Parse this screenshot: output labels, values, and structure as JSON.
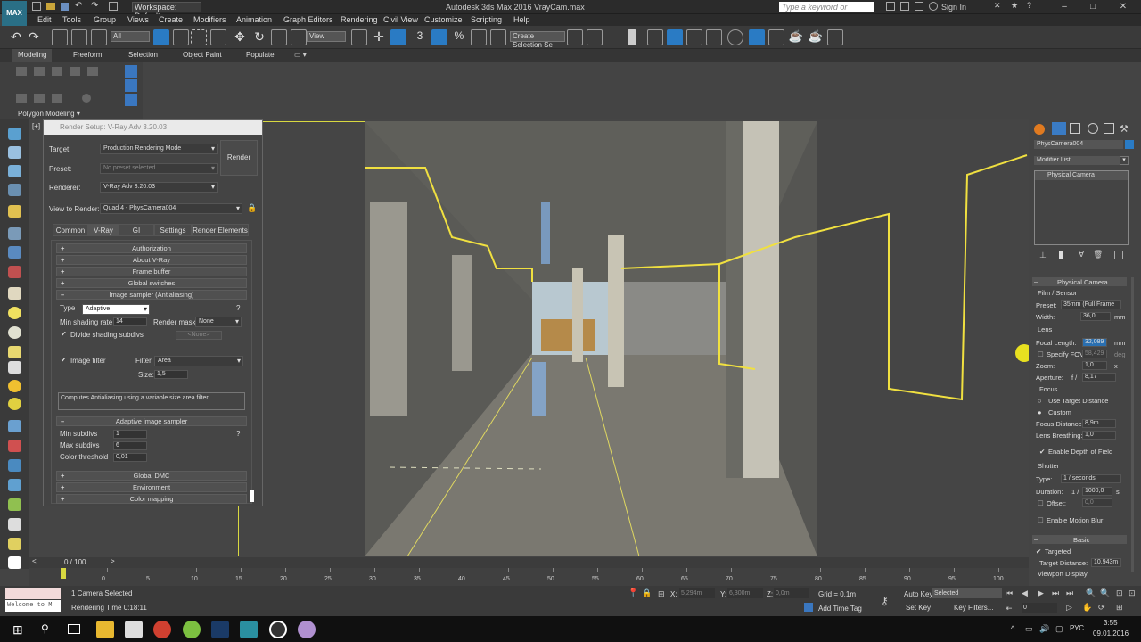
{
  "titlebar": {
    "logo": "MAX",
    "workspace": "Workspace: Default",
    "app_title": "Autodesk 3ds Max 2016    VrayCam.max",
    "search_placeholder": "Type a keyword or phrase",
    "sign_in": "Sign In",
    "min": "–",
    "max": "□",
    "close": "✕"
  },
  "menu": {
    "items": [
      "Edit",
      "Tools",
      "Group",
      "Views",
      "Create",
      "Modifiers",
      "Animation",
      "Graph Editors",
      "Rendering",
      "Civil View",
      "Customize",
      "Scripting",
      "Help"
    ]
  },
  "toolbar": {
    "selection_filter": "All",
    "ref_coord": "View",
    "named_selection": "Create Selection Se"
  },
  "ribbon": {
    "tabs": [
      "Modeling",
      "Freeform",
      "Selection",
      "Object Paint",
      "Populate"
    ],
    "panel_label": "Polygon Modeling ▾"
  },
  "dialog": {
    "title": "Render Setup: V-Ray Adv 3.20.03",
    "target_label": "Target:",
    "target_value": "Production Rendering Mode",
    "preset_label": "Preset:",
    "preset_value": "No preset selected",
    "renderer_label": "Renderer:",
    "renderer_value": "V-Ray Adv 3.20.03",
    "render_button": "Render",
    "view_label": "View to Render:",
    "view_value": "Quad 4 - PhysCamera004",
    "tabs": [
      "Common",
      "V-Ray",
      "GI",
      "Settings",
      "Render Elements"
    ],
    "rollouts_top": [
      "Authorization",
      "About V-Ray",
      "Frame buffer",
      "Global switches"
    ],
    "image_sampler": "Image sampler (Antialiasing)",
    "type_label": "Type",
    "type_value": "Adaptive",
    "min_shading_label": "Min shading rate",
    "min_shading_value": "14",
    "render_mask_label": "Render mask",
    "render_mask_value": "None",
    "divide_label": "Divide shading subdivs",
    "none_value": "<None>",
    "image_filter_label": "Image filter",
    "filter_label": "Filter",
    "filter_value": "Area",
    "size_label": "Size:",
    "size_value": "1,5",
    "description": "Computes Antialiasing using a variable size area filter.",
    "adaptive_sampler": "Adaptive image sampler",
    "min_subdivs_label": "Min subdivs",
    "min_subdivs_value": "1",
    "max_subdivs_label": "Max subdivs",
    "max_subdivs_value": "6",
    "color_threshold_label": "Color threshold",
    "color_threshold_value": "0,01",
    "rollouts_bottom": [
      "Global DMC",
      "Environment",
      "Color mapping"
    ],
    "help": "?"
  },
  "viewport": {
    "label": "[+]"
  },
  "cmdpanel": {
    "object_name": "PhysCamera004",
    "modifier_list": "Modifier List",
    "stack_item": "Physical Camera",
    "rollout": "Physical Camera",
    "film_sensor": "Film / Sensor",
    "preset_label": "Preset:",
    "preset_value": "35mm (Full Frame",
    "width_label": "Width:",
    "width_value": "36,0",
    "width_unit": "mm",
    "lens": "Lens",
    "focal_label": "Focal Length:",
    "focal_value": "32,089",
    "focal_unit": "mm",
    "specify_fov": "Specify FOV:",
    "fov_value": "58,429",
    "fov_unit": "deg",
    "zoom_label": "Zoom:",
    "zoom_value": "1,0",
    "zoom_unit": "x",
    "aperture_label": "Aperture:",
    "aperture_prefix": "f /",
    "aperture_value": "8,17",
    "focus": "Focus",
    "use_target": "Use Target Distance",
    "custom": "Custom",
    "focus_dist_label": "Focus Distance:",
    "focus_dist_value": "8,9m",
    "breathing_label": "Lens Breathing:",
    "breathing_value": "1,0",
    "enable_dof": "Enable Depth of Field",
    "shutter": "Shutter",
    "type_label": "Type:",
    "type_value": "1 / seconds",
    "duration_label": "Duration:",
    "duration_prefix": "1 /",
    "duration_value": "1000,0",
    "duration_unit": "s",
    "offset_label": "Offset:",
    "offset_value": "0,0",
    "motion_blur": "Enable Motion Blur",
    "basic": "Basic",
    "targeted": "Targeted",
    "target_dist_label": "Target Distance:",
    "target_dist_value": "10,943m",
    "viewport_display": "Viewport Display"
  },
  "timeline": {
    "frame": "0 / 100",
    "ticks": [
      "0",
      "5",
      "10",
      "15",
      "20",
      "25",
      "30",
      "35",
      "40",
      "45",
      "50",
      "55",
      "60",
      "65",
      "70",
      "75",
      "80",
      "85",
      "90",
      "95",
      "100"
    ]
  },
  "status": {
    "welcome": "Welcome to M",
    "selected": "1 Camera Selected",
    "render_time": "Rendering Time  0:18:11",
    "x_label": "X:",
    "x_value": "5,294m",
    "y_label": "Y:",
    "y_value": "6,300m",
    "z_label": "Z:",
    "z_value": "0,0m",
    "grid": "Grid = 0,1m",
    "add_time_tag": "Add Time Tag",
    "auto_key": "Auto Key",
    "selected_dd": "Selected",
    "set_key": "Set Key",
    "key_filters": "Key Filters...",
    "frame_field": "0"
  },
  "taskbar": {
    "lang": "РУС",
    "time": "3:55",
    "date": "09.01.2016"
  },
  "colors": {
    "accent": "#2a7bc4",
    "frame_yellow": "#d8d840",
    "spline_yellow": "#f0e040"
  }
}
